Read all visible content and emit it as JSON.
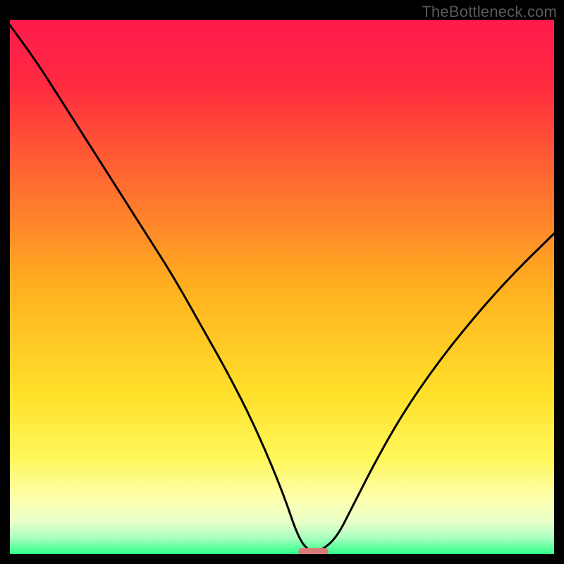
{
  "watermark": "TheBottleneck.com",
  "chart_data": {
    "type": "line",
    "title": "",
    "xlabel": "",
    "ylabel": "",
    "xlim": [
      0,
      100
    ],
    "ylim": [
      0,
      100
    ],
    "gradient_stops": [
      {
        "offset": 0,
        "color": "#ff1a4d"
      },
      {
        "offset": 12,
        "color": "#ff2a3f"
      },
      {
        "offset": 30,
        "color": "#ff6a30"
      },
      {
        "offset": 50,
        "color": "#ffb020"
      },
      {
        "offset": 70,
        "color": "#ffe02a"
      },
      {
        "offset": 82,
        "color": "#fff75a"
      },
      {
        "offset": 90,
        "color": "#fdffb0"
      },
      {
        "offset": 94,
        "color": "#e8ffc8"
      },
      {
        "offset": 97,
        "color": "#a8ffc0"
      },
      {
        "offset": 100,
        "color": "#2dff87"
      }
    ],
    "series": [
      {
        "name": "bottleneck-curve",
        "x": [
          0,
          5,
          10,
          15,
          20,
          25,
          30,
          35,
          40,
          45,
          50,
          53,
          55,
          57,
          60,
          63,
          67,
          72,
          78,
          85,
          92,
          100
        ],
        "y": [
          99,
          92,
          84,
          76,
          68,
          60,
          52,
          43,
          34,
          24,
          12,
          3,
          0.5,
          0.5,
          3,
          9,
          17,
          26,
          35,
          44,
          52,
          60
        ]
      }
    ],
    "marker": {
      "name": "bottleneck-marker",
      "x_start": 53,
      "x_end": 58.5,
      "y": 0.5,
      "color": "#d87a78"
    }
  }
}
